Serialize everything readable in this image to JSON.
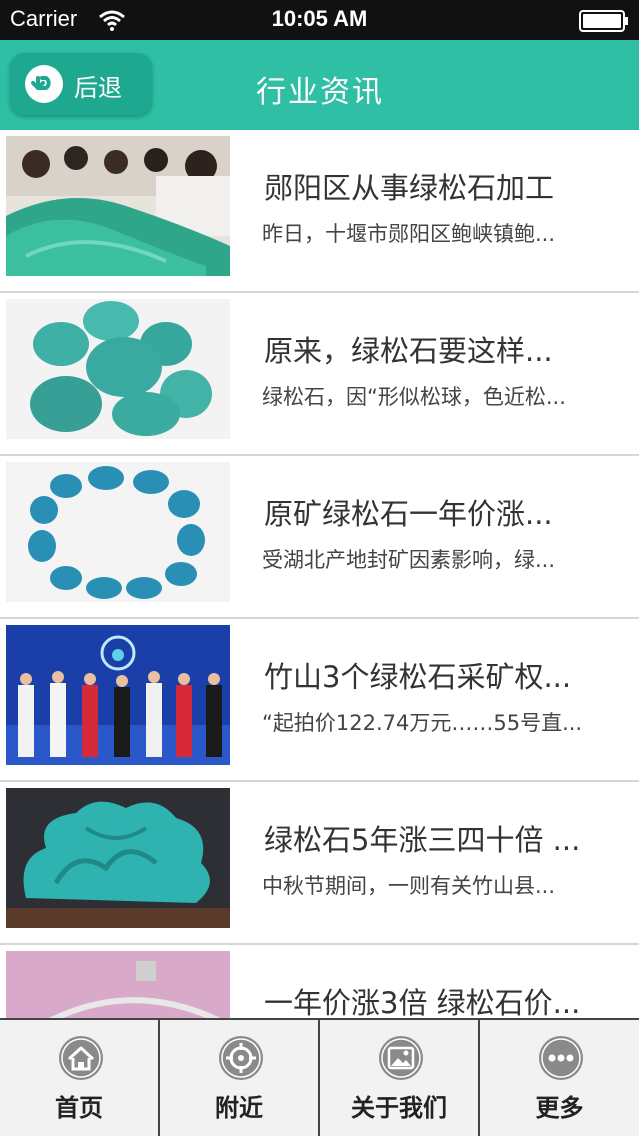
{
  "status_bar": {
    "carrier": "Carrier",
    "time": "10:05 AM"
  },
  "nav": {
    "back_label": "后退",
    "title": "行业资讯"
  },
  "news": [
    {
      "title": "郧阳区从事绿松石加工",
      "summary": "昨日，十堰市郧阳区鲍峡镇鲍..."
    },
    {
      "title": "原来，绿松石要这样...",
      "summary": "绿松石，因“形似松球，色近松..."
    },
    {
      "title": "原矿绿松石一年价涨...",
      "summary": "受湖北产地封矿因素影响，绿..."
    },
    {
      "title": "竹山3个绿松石采矿权...",
      "summary": "“起拍价122.74万元……55号直..."
    },
    {
      "title": "绿松石5年涨三四十倍 ...",
      "summary": "中秋节期间，一则有关竹山县..."
    },
    {
      "title": "一年价涨3倍 绿松石价...",
      "summary": ""
    }
  ],
  "tabs": [
    {
      "label": "首页",
      "icon": "home-icon"
    },
    {
      "label": "附近",
      "icon": "target-icon"
    },
    {
      "label": "关于我们",
      "icon": "image-icon"
    },
    {
      "label": "更多",
      "icon": "more-icon"
    }
  ],
  "colors": {
    "accent": "#2ebfa5",
    "back_button": "#1ea88f",
    "status_bar": "#111111",
    "tab_icon": "#8a8a8a"
  }
}
